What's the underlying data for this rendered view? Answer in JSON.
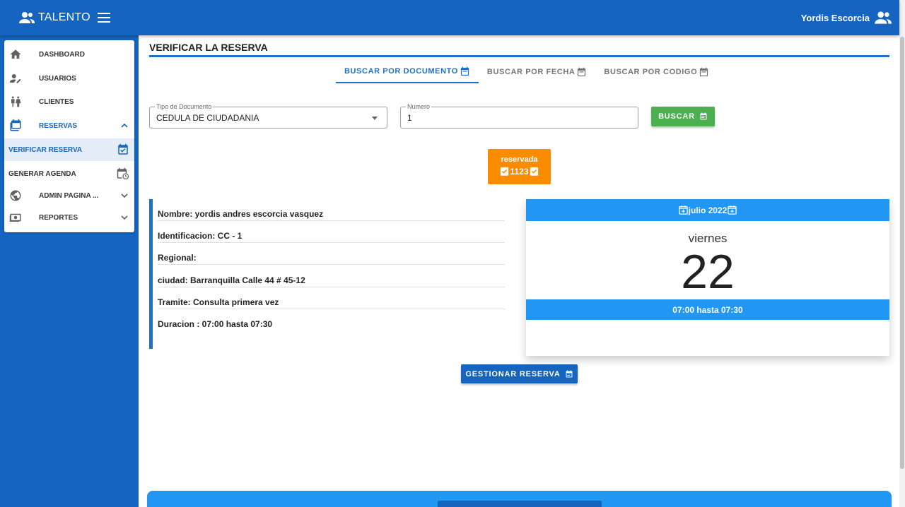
{
  "app": {
    "title": "TALENTO",
    "user_name": "Yordis Escorcia"
  },
  "sidebar": {
    "items": [
      {
        "label": "DASHBOARD"
      },
      {
        "label": "USUARIOS"
      },
      {
        "label": "CLIENTES"
      },
      {
        "label": "RESERVAS"
      },
      {
        "label": "VERIFICAR RESERVA"
      },
      {
        "label": "GENERAR AGENDA"
      },
      {
        "label": "ADMIN PAGINA ..."
      },
      {
        "label": "REPORTES"
      }
    ]
  },
  "page": {
    "title": "VERIFICAR LA RESERVA"
  },
  "tabs": [
    {
      "label": "BUSCAR POR DOCUMENTO"
    },
    {
      "label": "BUSCAR POR FECHA"
    },
    {
      "label": "BUSCAR POR CODIGO"
    }
  ],
  "form": {
    "doc_type_label": "Tipo de Documento",
    "doc_type_value": "CEDULA DE CIUDADANIA",
    "number_label": "Numero",
    "number_value": "1",
    "search_button": "BUSCAR"
  },
  "status": {
    "label": "reservada",
    "code": "1123",
    "color": "#fb8c00"
  },
  "details": {
    "nombre": "Nombre: yordis andres escorcia vasquez",
    "identificacion": "Identificacion: CC - 1",
    "regional": "Regional:",
    "ciudad": "ciudad: Barranquilla Calle 44 # 45-12",
    "tramite": "Tramite: Consulta primera vez",
    "duracion": "Duracion : 07:00 hasta 07:30"
  },
  "calendar": {
    "month": "julio 2022",
    "weekday": "viernes",
    "day": "22",
    "time_range": "07:00 hasta 07:30"
  },
  "actions": {
    "manage_button": "GESTIONAR RESERVA"
  },
  "colors": {
    "primary": "#1565c0",
    "accent": "#2196f3",
    "success": "#4caf50",
    "warning": "#fb8c00"
  }
}
